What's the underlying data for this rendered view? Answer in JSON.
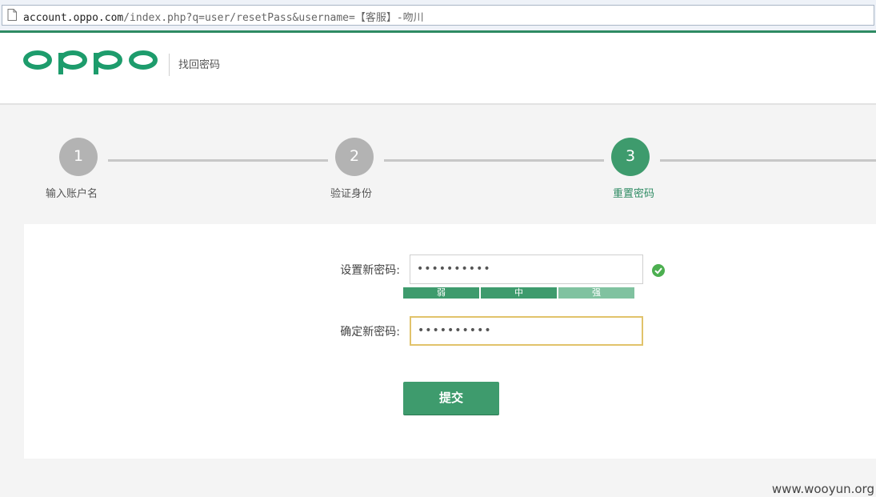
{
  "browser": {
    "url_host": "account.oppo.com",
    "url_path": "/index.php?q=user/resetPass&username=【客服】-吻川"
  },
  "header": {
    "logo_text": "oppo",
    "title": "找回密码"
  },
  "steps": [
    {
      "number": "1",
      "label": "输入账户名",
      "active": false
    },
    {
      "number": "2",
      "label": "验证身份",
      "active": false
    },
    {
      "number": "3",
      "label": "重置密码",
      "active": true
    }
  ],
  "form": {
    "new_password_label": "设置新密码:",
    "new_password_value": "••••••••••",
    "confirm_password_label": "确定新密码:",
    "confirm_password_value": "••••••••••",
    "strength_levels": [
      "弱",
      "中",
      "强"
    ],
    "strength_active": 2,
    "submit_label": "提交"
  },
  "watermark": "www.wooyun.org",
  "colors": {
    "brand_green": "#3e9b6d",
    "step_inactive": "#b3b3b3",
    "focus_border": "#e1c36b"
  }
}
